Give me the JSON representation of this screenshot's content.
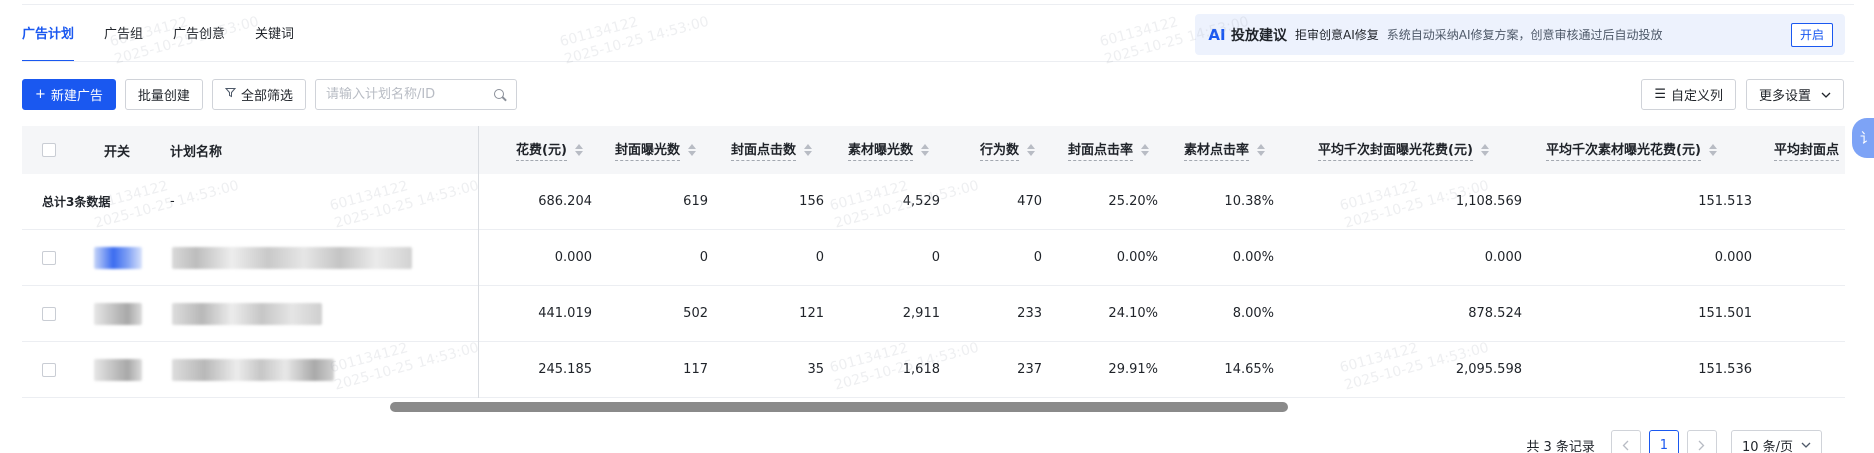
{
  "tabs": [
    {
      "label": "广告计划",
      "active": true
    },
    {
      "label": "广告组",
      "active": false
    },
    {
      "label": "广告创意",
      "active": false
    },
    {
      "label": "关键词",
      "active": false
    }
  ],
  "ai_banner": {
    "logo": "AI",
    "title": "投放建议",
    "subtitle": "拒审创意AI修复",
    "description": "系统自动采纳AI修复方案，创意审核通过后自动投放",
    "button": "开启"
  },
  "toolbar": {
    "new_ad": "新建广告",
    "batch_create": "批量创建",
    "filter_all": "全部筛选",
    "search_placeholder": "请输入计划名称/ID",
    "customize_columns": "自定义列",
    "more_settings": "更多设置"
  },
  "table": {
    "headers": {
      "switch": "开关",
      "name": "计划名称",
      "spend": "花费(元)",
      "cover_impressions": "封面曝光数",
      "cover_clicks": "封面点击数",
      "material_impressions": "素材曝光数",
      "actions": "行为数",
      "cover_ctr": "封面点击率",
      "material_ctr": "素材点击率",
      "cpm_cover": "平均千次封面曝光花费(元)",
      "cpm_material": "平均千次素材曝光花费(元)",
      "avg_cover_cpc": "平均封面点"
    },
    "summary": {
      "label": "总计3条数据",
      "name": "-",
      "spend": "686.204",
      "cover_impressions": "619",
      "cover_clicks": "156",
      "material_impressions": "4,529",
      "actions": "470",
      "cover_ctr": "25.20%",
      "material_ctr": "10.38%",
      "cpm_cover": "1,108.569",
      "cpm_material": "151.513"
    },
    "rows": [
      {
        "spend": "0.000",
        "cover_impressions": "0",
        "cover_clicks": "0",
        "material_impressions": "0",
        "actions": "0",
        "cover_ctr": "0.00%",
        "material_ctr": "0.00%",
        "cpm_cover": "0.000",
        "cpm_material": "0.000",
        "switch_on": true
      },
      {
        "spend": "441.019",
        "cover_impressions": "502",
        "cover_clicks": "121",
        "material_impressions": "2,911",
        "actions": "233",
        "cover_ctr": "24.10%",
        "material_ctr": "8.00%",
        "cpm_cover": "878.524",
        "cpm_material": "151.501",
        "switch_on": false
      },
      {
        "spend": "245.185",
        "cover_impressions": "117",
        "cover_clicks": "35",
        "material_impressions": "1,618",
        "actions": "237",
        "cover_ctr": "29.91%",
        "material_ctr": "14.65%",
        "cpm_cover": "2,095.598",
        "cpm_material": "151.536",
        "switch_on": false
      }
    ]
  },
  "pagination": {
    "total": "共 3 条记录",
    "current_page": "1",
    "page_size": "10 条/页"
  },
  "side_tab": "讠",
  "watermark": {
    "id": "601134122",
    "time": "2025-10-25 14:53:00"
  },
  "colors": {
    "primary": "#1a58f0",
    "banner_bg": "#edf2fd",
    "header_bg": "#f5f6f8"
  }
}
